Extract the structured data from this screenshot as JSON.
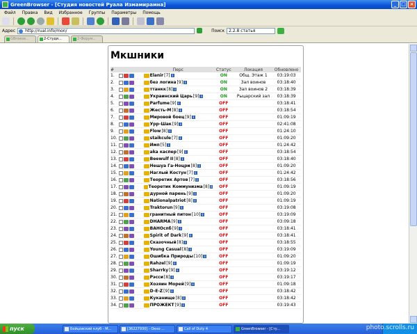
{
  "window": {
    "title": "GreenBrowser - [Студия новостей Руала Измамирамна]"
  },
  "menu": [
    "Файл",
    "Правка",
    "Вид",
    "Избранное",
    "Группы",
    "Параметры",
    "Помощь"
  ],
  "address": {
    "label": "Адрес",
    "value": "http://rual.info/mon/",
    "search_label": "Поиск",
    "search_value": "2.2.8 статья"
  },
  "tabs": [
    {
      "label": "GBrowse..."
    },
    {
      "label": "2-Студи..."
    },
    {
      "label": "2-Форум..."
    }
  ],
  "page": {
    "title": "Мкшники",
    "columns": [
      "#",
      "",
      "Перс",
      "Статус",
      "Локация",
      "Обновлено"
    ],
    "rows": [
      {
        "num": "1.",
        "name": "Elanir",
        "level": "[7]",
        "status": "ON",
        "loc": "Общ. Этаж 1",
        "time": "03:19:03"
      },
      {
        "num": "2.",
        "name": "без логина",
        "level": "[9]",
        "status": "ON",
        "loc": "Зал воинов",
        "time": "03:18:40"
      },
      {
        "num": "3.",
        "name": "ттанкк",
        "level": "[8]",
        "status": "ON",
        "loc": "Зал воинов 2",
        "time": "03:18:39"
      },
      {
        "num": "4.",
        "name": "Украинский Царь",
        "level": "[9]",
        "status": "ON",
        "loc": "Рыцарский зал",
        "time": "03:18:39"
      },
      {
        "num": "5.",
        "name": "Parfume",
        "level": "[9]",
        "status": "OFF",
        "loc": "",
        "time": "03:18:41"
      },
      {
        "num": "6.",
        "name": "Жесть-М",
        "level": "[8]",
        "status": "OFF",
        "loc": "",
        "time": "03:18:54"
      },
      {
        "num": "7.",
        "name": "Мировой боец",
        "level": "[9]",
        "status": "OFF",
        "loc": "",
        "time": "01:09:19"
      },
      {
        "num": "8.",
        "name": "Урр-Шак",
        "level": "[9]",
        "status": "OFF",
        "loc": "",
        "time": "02:41:08"
      },
      {
        "num": "9.",
        "name": "Flow",
        "level": "[8]",
        "status": "OFF",
        "loc": "",
        "time": "01:24:10"
      },
      {
        "num": "10.",
        "name": "staikcule",
        "level": "[7]",
        "status": "OFF",
        "loc": "",
        "time": "01:09:20"
      },
      {
        "num": "11.",
        "name": "Имп",
        "level": "[5]",
        "status": "OFF",
        "loc": "",
        "time": "01:24:42"
      },
      {
        "num": "12.",
        "name": "aka каспер",
        "level": "[9]",
        "status": "OFF",
        "loc": "",
        "time": "03:18:54"
      },
      {
        "num": "13.",
        "name": "Beewulf II",
        "level": "[8]",
        "status": "OFF",
        "loc": "",
        "time": "03:18:40"
      },
      {
        "num": "14.",
        "name": "Нешуа Га-Ноцри",
        "level": "[8]",
        "status": "OFF",
        "loc": "",
        "time": "01:09:20"
      },
      {
        "num": "15.",
        "name": "Наглый Костун",
        "level": "[7]",
        "status": "OFF",
        "loc": "",
        "time": "01:24:42"
      },
      {
        "num": "16.",
        "name": "Теоретик Артов",
        "level": "[7]",
        "status": "OFF",
        "loc": "",
        "time": "03:18:56"
      },
      {
        "num": "17.",
        "name": "Теоретик Коммунизма",
        "level": "[8]",
        "status": "OFF",
        "loc": "",
        "time": "01:09:19"
      },
      {
        "num": "18.",
        "name": "дурной парень",
        "level": "[9]",
        "status": "OFF",
        "loc": "",
        "time": "01:09:20"
      },
      {
        "num": "19.",
        "name": "Nationalpatriot",
        "level": "[8]",
        "status": "OFF",
        "loc": "",
        "time": "01:09:19"
      },
      {
        "num": "20.",
        "name": "Traktorun",
        "level": "[9]",
        "status": "OFF",
        "loc": "",
        "time": "03:19:08"
      },
      {
        "num": "21.",
        "name": "гранитный питон",
        "level": "[10]",
        "status": "OFF",
        "loc": "",
        "time": "03:19:09"
      },
      {
        "num": "22.",
        "name": "DHARMA",
        "level": "[9]",
        "status": "OFF",
        "loc": "",
        "time": "03:09:18"
      },
      {
        "num": "23.",
        "name": "ВАНОспб",
        "level": "[9]",
        "status": "OFF",
        "loc": "",
        "time": "03:18:41"
      },
      {
        "num": "24.",
        "name": "Spirit of Dark",
        "level": "[9]",
        "status": "OFF",
        "loc": "",
        "time": "03:18:41"
      },
      {
        "num": "25.",
        "name": "Сказочный",
        "level": "[8]",
        "status": "OFF",
        "loc": "",
        "time": "03:18:55"
      },
      {
        "num": "26.",
        "name": "Young Casual",
        "level": "[8]",
        "status": "OFF",
        "loc": "",
        "time": "03:19:09"
      },
      {
        "num": "27.",
        "name": "Ошибка Природы",
        "level": "[10]",
        "status": "OFF",
        "loc": "",
        "time": "01:09:20"
      },
      {
        "num": "28.",
        "name": "Rahzel",
        "level": "[9]",
        "status": "OFF",
        "loc": "",
        "time": "01:09:19"
      },
      {
        "num": "29.",
        "name": "Sharrky",
        "level": "[9]",
        "status": "OFF",
        "loc": "",
        "time": "03:19:12"
      },
      {
        "num": "30.",
        "name": "Рэсси",
        "level": "[8]",
        "status": "OFF",
        "loc": "",
        "time": "03:19:17"
      },
      {
        "num": "31.",
        "name": "Хозяин Морей",
        "level": "[9]",
        "status": "OFF",
        "loc": "",
        "time": "01:09:18"
      },
      {
        "num": "32.",
        "name": "D-E-Z",
        "level": "[9]",
        "status": "OFF",
        "loc": "",
        "time": "03:18:42"
      },
      {
        "num": "33.",
        "name": "Куканище",
        "level": "[8]",
        "status": "OFF",
        "loc": "",
        "time": "03:18:42"
      },
      {
        "num": "34.",
        "name": "ПРОЖЕКТ",
        "level": "[9]",
        "status": "OFF",
        "loc": "",
        "time": "03:19:43"
      }
    ]
  },
  "taskbar": {
    "start": "пуск",
    "items": [
      {
        "label": "Бойцовский клуб - М..."
      },
      {
        "label": "[36227930] - Окно ..."
      },
      {
        "label": "Call of Duty 4"
      },
      {
        "label": "GreenBrowser - [Сту..."
      }
    ]
  },
  "watermark": "photo.scrolls.ru",
  "colors": {
    "on": "#1a9a1a",
    "off": "#e01010",
    "titlebar": "#0a54d8",
    "taskbar": "#245edb"
  }
}
